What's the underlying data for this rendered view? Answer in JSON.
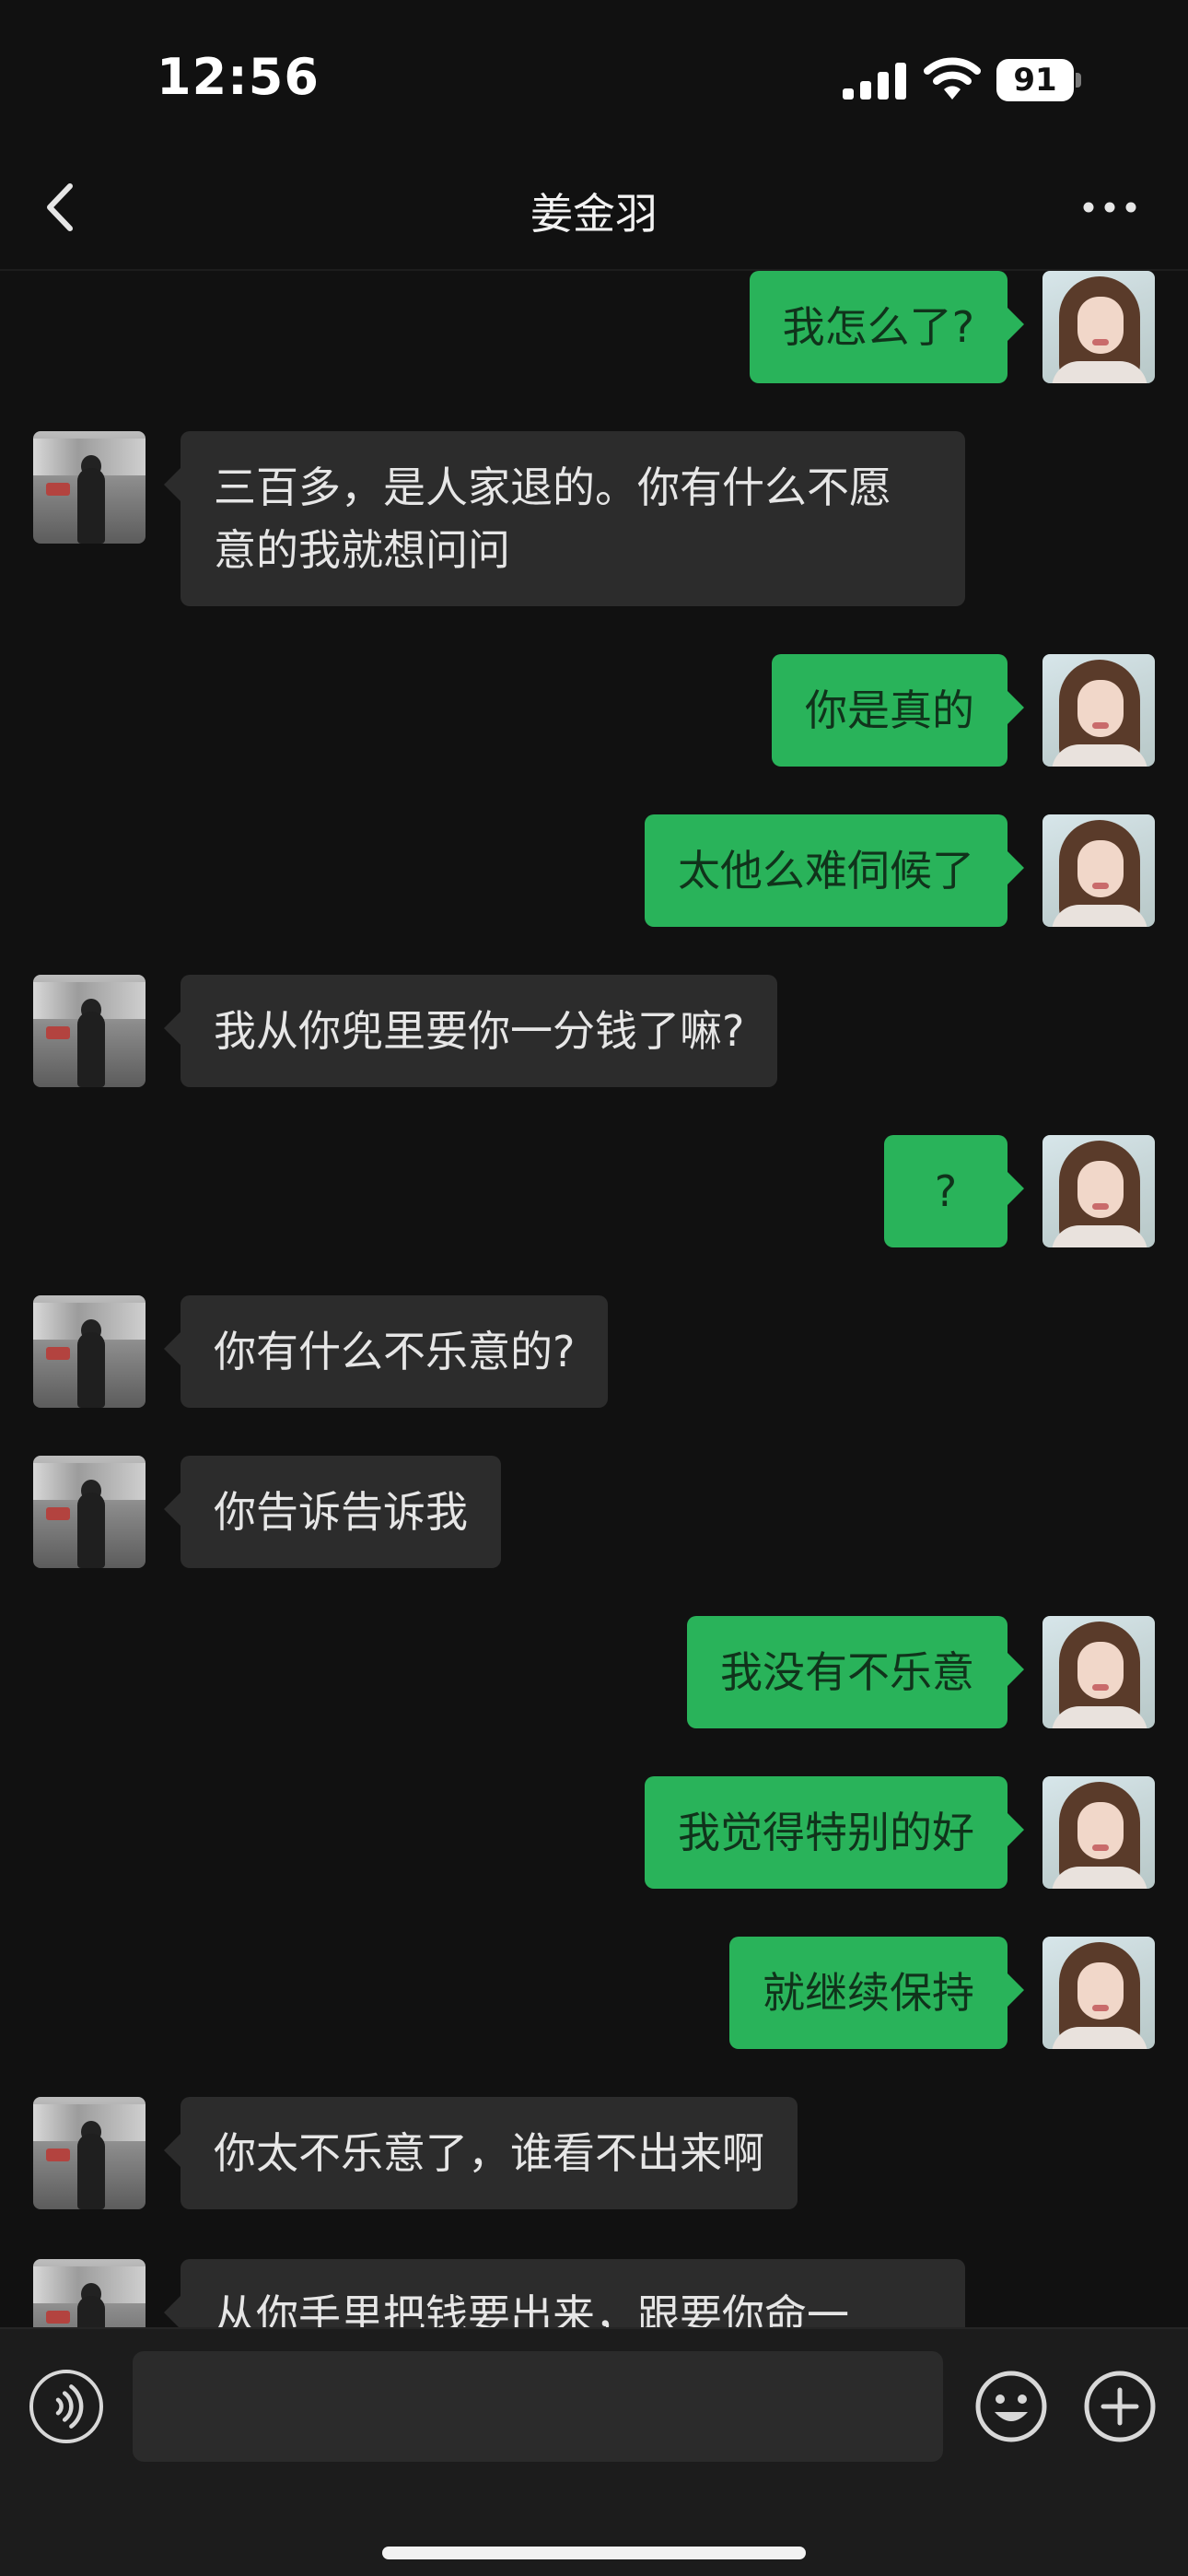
{
  "status_bar": {
    "time": "12:56",
    "battery": "91"
  },
  "nav": {
    "title": "姜金羽"
  },
  "messages": [
    {
      "side": "out",
      "text": "我怎么了?"
    },
    {
      "side": "in",
      "text": "三百多，是人家退的。你有什么不愿意的我就想问问"
    },
    {
      "side": "out",
      "text": "你是真的"
    },
    {
      "side": "out",
      "text": "太他么难伺候了"
    },
    {
      "side": "in",
      "text": "我从你兜里要你一分钱了嘛?"
    },
    {
      "side": "out",
      "text": "?"
    },
    {
      "side": "in",
      "text": "你有什么不乐意的?"
    },
    {
      "side": "in",
      "text": "你告诉告诉我"
    },
    {
      "side": "out",
      "text": "我没有不乐意"
    },
    {
      "side": "out",
      "text": "我觉得特别的好"
    },
    {
      "side": "out",
      "text": "就继续保持"
    },
    {
      "side": "in",
      "text": "你太不乐意了，谁看不出来啊"
    },
    {
      "side": "in",
      "text": "从你手里把钱要出来，跟要你命一"
    }
  ],
  "input": {
    "placeholder": ""
  },
  "icons": {
    "back": "chevron-left-icon",
    "more": "ellipsis-icon",
    "voice": "voice-icon",
    "emoji": "emoji-icon",
    "plus": "plus-icon"
  },
  "colors": {
    "outgoing_bubble": "#29b35a",
    "incoming_bubble": "#2c2c2c",
    "background": "#111111"
  }
}
